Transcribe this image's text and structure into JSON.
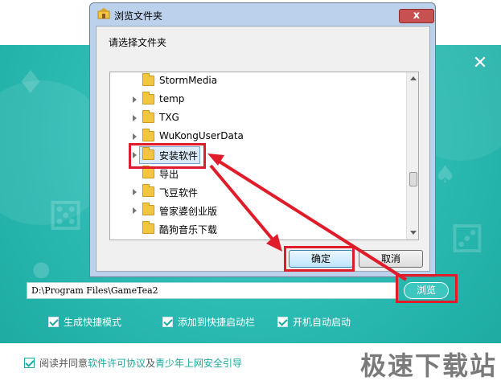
{
  "installer": {
    "path_value": "D:\\Program Files\\GameTea2",
    "browse_label": "浏览",
    "options": [
      "生成快捷模式",
      "添加到快捷启动栏",
      "开机自动启动"
    ],
    "agree_prefix": "阅读并同意",
    "license_link": "软件许可协议",
    "and_text": "及",
    "guide_link": "青少年上网安全引导",
    "close_icon": "close-icon",
    "accent": "#2ebdb5"
  },
  "dialog": {
    "title": "浏览文件夹",
    "prompt": "请选择文件夹",
    "tree": [
      {
        "label": "StormMedia",
        "arrow": false
      },
      {
        "label": "temp",
        "arrow": true
      },
      {
        "label": "TXG",
        "arrow": true
      },
      {
        "label": "WuKongUserData",
        "arrow": true
      },
      {
        "label": "安装软件",
        "arrow": true,
        "selected": true
      },
      {
        "label": "导出",
        "arrow": false
      },
      {
        "label": "飞豆软件",
        "arrow": true
      },
      {
        "label": "管家婆创业版",
        "arrow": true
      },
      {
        "label": "酷狗音乐下载",
        "arrow": false
      }
    ],
    "ok_label": "确定",
    "cancel_label": "取消",
    "close_symbol": "x"
  },
  "watermark": "极速下载站",
  "highlight_color": "#e01c2a"
}
